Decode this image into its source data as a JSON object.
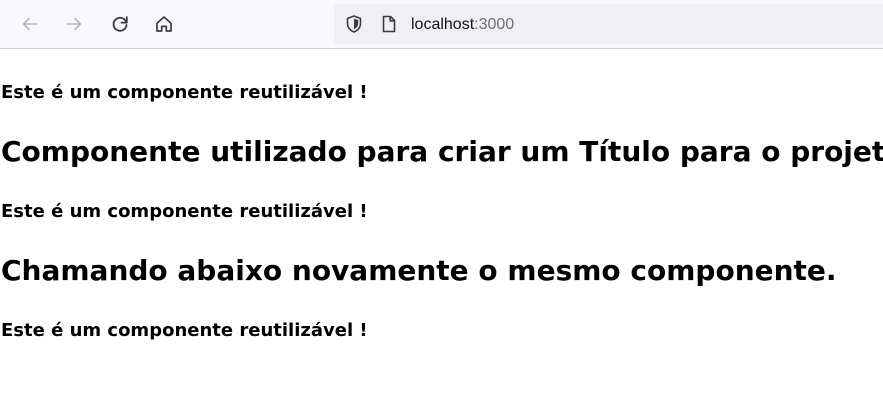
{
  "browser": {
    "back_icon": "arrow-left-icon",
    "forward_icon": "arrow-right-icon",
    "reload_icon": "reload-icon",
    "home_icon": "home-icon",
    "shield_icon": "shield-icon",
    "page_icon": "page-icon",
    "url_host": "localhost",
    "url_port": ":3000"
  },
  "page": {
    "reusable_1": "Este é um componente reutilizável !",
    "title_1": "Componente utilizado para criar um Título para o projeto",
    "reusable_2": "Este é um componente reutilizável !",
    "title_2": "Chamando abaixo novamente o mesmo componente.",
    "reusable_3": "Este é um componente reutilizável !"
  }
}
